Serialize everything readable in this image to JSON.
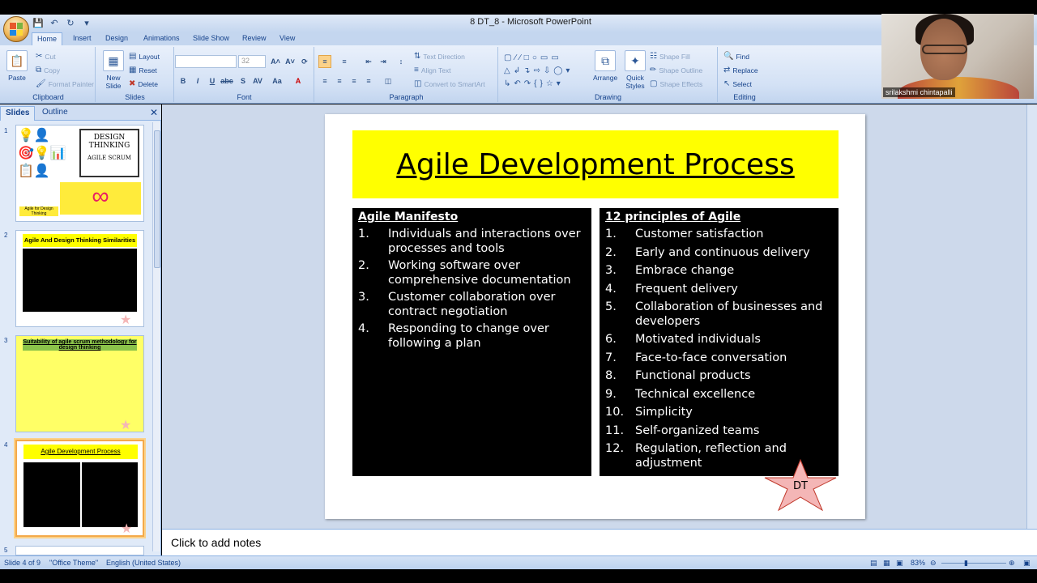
{
  "window": {
    "title": "8 DT_8 - Microsoft PowerPoint"
  },
  "tabs": [
    "Home",
    "Insert",
    "Design",
    "Animations",
    "Slide Show",
    "Review",
    "View"
  ],
  "ribbon": {
    "clipboard": {
      "paste": "Paste",
      "cut": "Cut",
      "copy": "Copy",
      "format_painter": "Format Painter",
      "label": "Clipboard"
    },
    "slides": {
      "new_slide": "New Slide",
      "layout": "Layout",
      "reset": "Reset",
      "delete": "Delete",
      "label": "Slides"
    },
    "font": {
      "size": "32",
      "label": "Font"
    },
    "paragraph": {
      "text_direction": "Text Direction",
      "align_text": "Align Text",
      "convert_smartart": "Convert to SmartArt",
      "label": "Paragraph"
    },
    "drawing": {
      "arrange": "Arrange",
      "quick_styles": "Quick Styles",
      "shape_fill": "Shape Fill",
      "shape_outline": "Shape Outline",
      "shape_effects": "Shape Effects",
      "label": "Drawing"
    },
    "editing": {
      "find": "Find",
      "replace": "Replace",
      "select": "Select",
      "label": "Editing"
    }
  },
  "left_pane": {
    "tabs": [
      "Slides",
      "Outline"
    ],
    "thumbnails": [
      {
        "num": "1",
        "title": "DESIGN THINKING",
        "subtitle": "AGILE SCRUM",
        "caption": "Agile for Design Thinking"
      },
      {
        "num": "2",
        "title": "Agile And Design Thinking Similarities"
      },
      {
        "num": "3",
        "title": "Suitability of agile scrum methodology for design thinking"
      },
      {
        "num": "4",
        "title": "Agile Development Process"
      },
      {
        "num": "5"
      }
    ]
  },
  "slide": {
    "title": "Agile Development Process",
    "left": {
      "heading": "Agile Manifesto",
      "items": [
        {
          "n": "1.",
          "text": "Individuals and interactions over processes and tools"
        },
        {
          "n": "2.",
          "text": "Working software over comprehensive documentation"
        },
        {
          "n": "3.",
          "text": "Customer collaboration over contract negotiation"
        },
        {
          "n": "4.",
          "text": "Responding to change over following a plan"
        }
      ]
    },
    "right": {
      "heading": "12 principles of Agile",
      "items": [
        {
          "n": "1.",
          "text": "Customer satisfaction"
        },
        {
          "n": "2.",
          "text": "Early and continuous delivery"
        },
        {
          "n": "3.",
          "text": "Embrace change"
        },
        {
          "n": "4.",
          "text": "Frequent delivery"
        },
        {
          "n": "5.",
          "text": "Collaboration of businesses and developers"
        },
        {
          "n": "6.",
          "text": "Motivated individuals"
        },
        {
          "n": "7.",
          "text": "Face-to-face conversation"
        },
        {
          "n": "8.",
          "text": "Functional products"
        },
        {
          "n": "9.",
          "text": "Technical excellence"
        },
        {
          "n": "10.",
          "text": "Simplicity"
        },
        {
          "n": "11.",
          "text": "Self-organized teams"
        },
        {
          "n": "12.",
          "text": "Regulation, reflection and adjustment"
        }
      ]
    },
    "star_label": "DT"
  },
  "notes": {
    "placeholder": "Click to add notes"
  },
  "status": {
    "slide": "Slide 4 of 9",
    "theme": "\"Office Theme\"",
    "language": "English (United States)",
    "zoom": "83%"
  },
  "webcam": {
    "name": "srilakshmi chintapalli"
  },
  "colors": {
    "title_bg": "#ffff00",
    "panel_bg": "#000000",
    "star": "#f4b6b6",
    "selection": "#f4a94a"
  }
}
